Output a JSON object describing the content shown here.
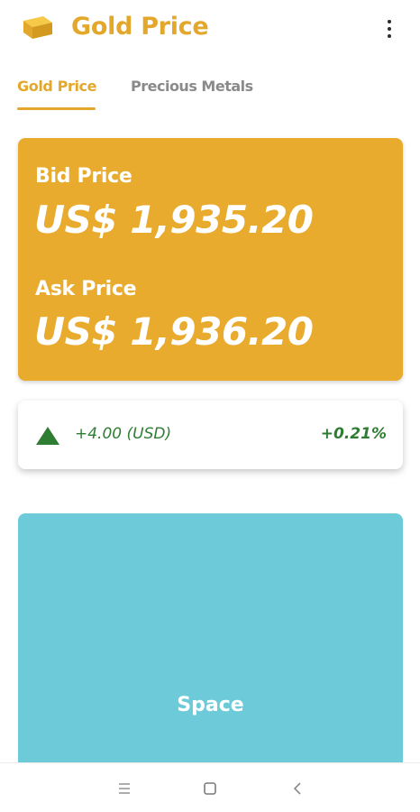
{
  "app": {
    "title": "Gold Price",
    "accent_color": "#E3A82B",
    "menu_icon": "more-vert-icon",
    "logo_icon": "gold-bar-icon"
  },
  "tabs": [
    {
      "label": "Gold Price",
      "active": true
    },
    {
      "label": "Precious Metals",
      "active": false
    }
  ],
  "price_card": {
    "bid_label": "Bid Price",
    "bid_value": "US$ 1,935.20",
    "ask_label": "Ask Price",
    "ask_value": "US$ 1,936.20",
    "background_color": "#E9AB2D"
  },
  "change": {
    "direction_icon": "triangle-up-icon",
    "amount": "+4.00 (USD)",
    "percent": "+0.21%",
    "color": "#2E7D32"
  },
  "space_card": {
    "label": "Space",
    "background_color": "#6CCAD9"
  },
  "navbar": {
    "icons": [
      "recents-icon",
      "home-icon",
      "back-icon"
    ]
  }
}
